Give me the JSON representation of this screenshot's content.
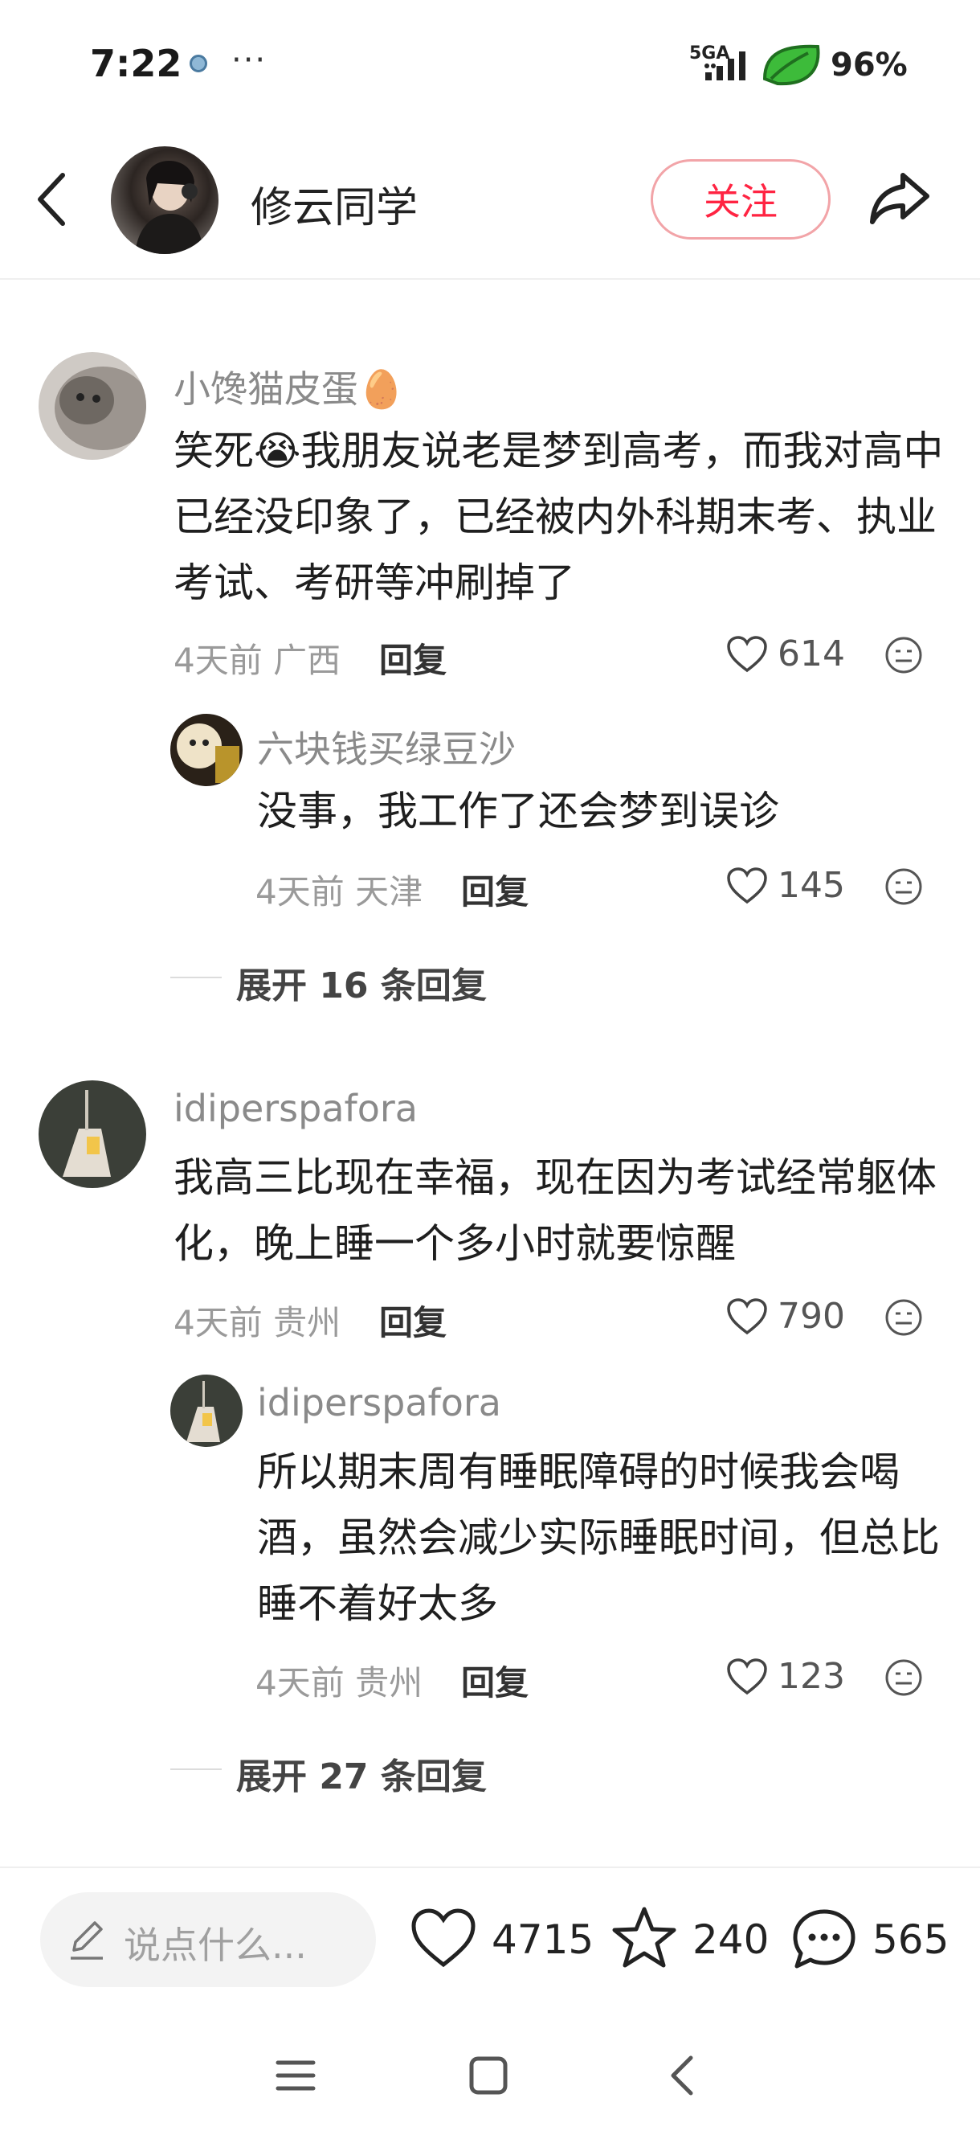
{
  "status_bar": {
    "time": "7:22",
    "extra": "···",
    "network": "5GA",
    "battery": "96%"
  },
  "header": {
    "author_name": "修云同学",
    "follow_label": "关注"
  },
  "comments": [
    {
      "username": "小馋猫皮蛋",
      "emoji": "🥚",
      "text_before": "笑死",
      "inline_emoji": "😭",
      "text_after": "我朋友说老是梦到高考，而我对高中已经没印象了，已经被内外科期末考、执业考试、考研等冲刷掉了",
      "time": "4天前",
      "location": "广西",
      "reply_label": "回复",
      "likes": "614",
      "replies": [
        {
          "username": "六块钱买绿豆沙",
          "text": "没事，我工作了还会梦到误诊",
          "time": "4天前",
          "location": "天津",
          "reply_label": "回复",
          "likes": "145"
        }
      ],
      "expand_label": "展开 16 条回复"
    },
    {
      "username": "idiperspafora",
      "text": "我高三比现在幸福，现在因为考试经常躯体化，晚上睡一个多小时就要惊醒",
      "time": "4天前",
      "location": "贵州",
      "reply_label": "回复",
      "likes": "790",
      "replies": [
        {
          "username": "idiperspafora",
          "text": "所以期末周有睡眠障碍的时候我会喝酒，虽然会减少实际睡眠时间，但总比睡不着好太多",
          "time": "4天前",
          "location": "贵州",
          "reply_label": "回复",
          "likes": "123"
        }
      ],
      "expand_label": "展开 27 条回复"
    }
  ],
  "bottom_bar": {
    "input_placeholder": "说点什么...",
    "likes": "4715",
    "favorites": "240",
    "comments": "565"
  },
  "colors": {
    "accent": "#ff2442",
    "follow_border": "#f2a4a8",
    "battery_leaf": "#3dbb3a"
  },
  "icons": [
    "back-arrow-icon",
    "share-icon",
    "heart-icon",
    "emoji-face-icon",
    "pencil-icon",
    "star-icon",
    "comment-bubble-icon",
    "menu-icon",
    "home-square-icon",
    "nav-back-icon"
  ]
}
